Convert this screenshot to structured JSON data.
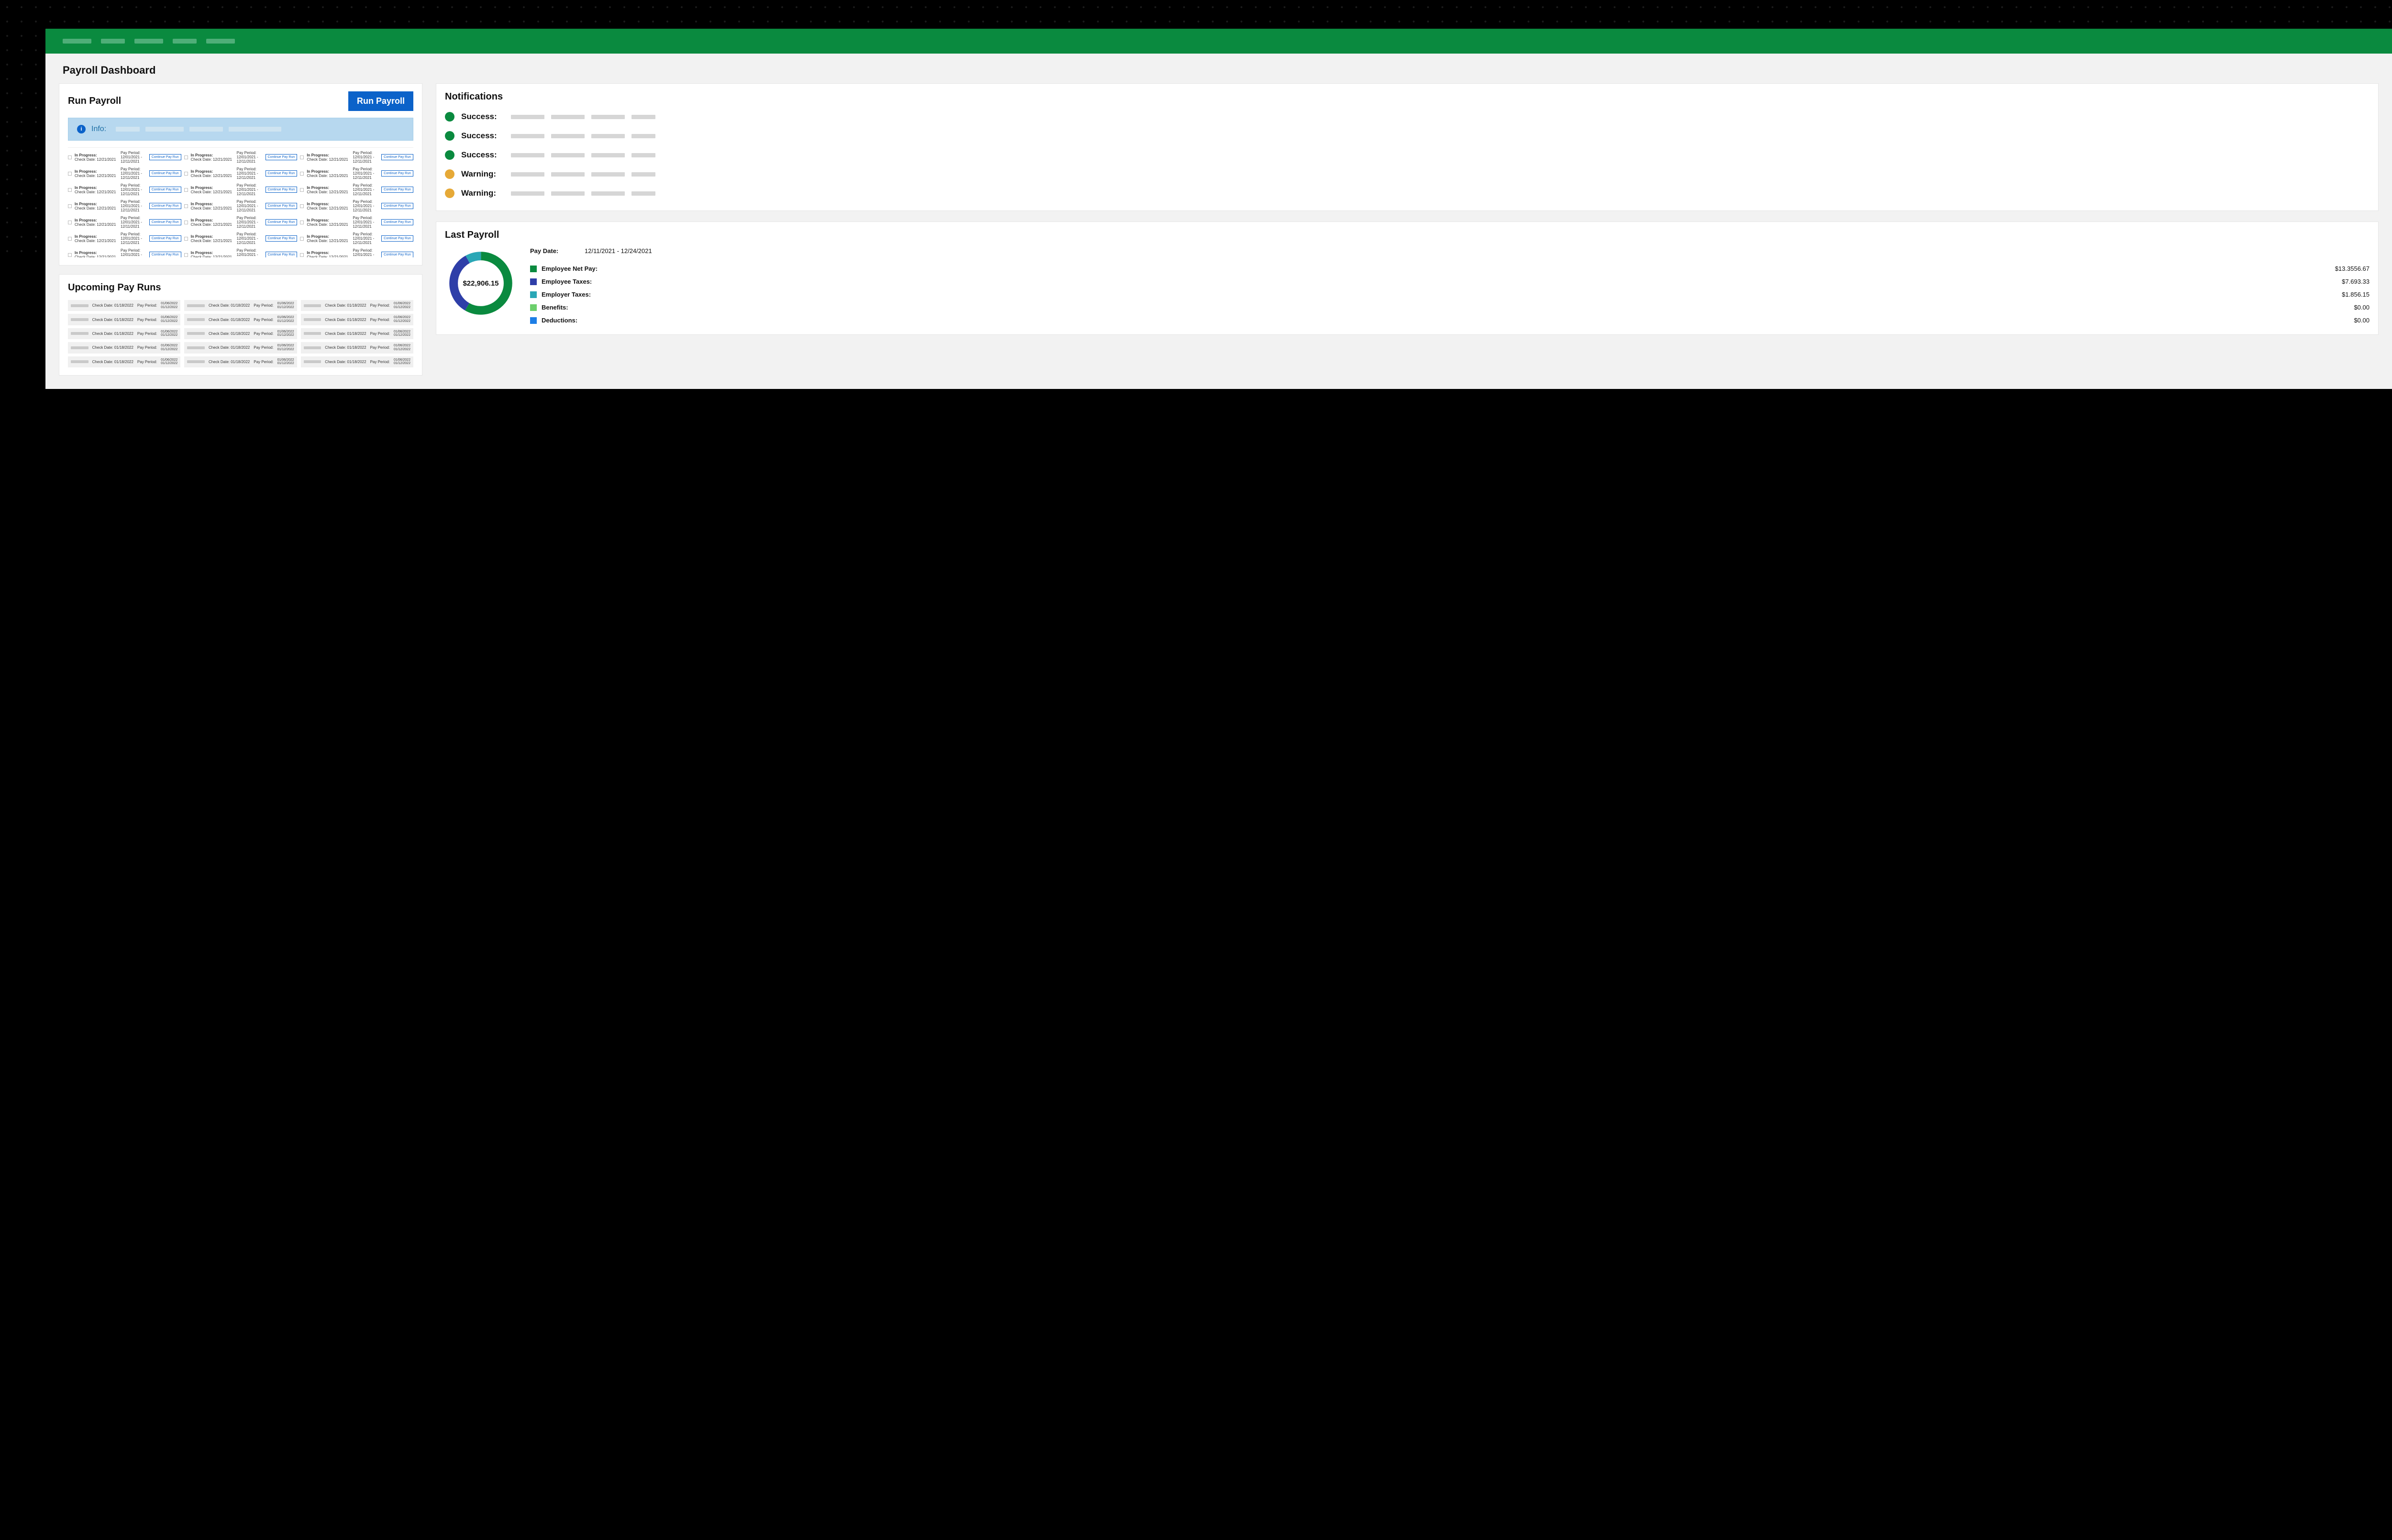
{
  "page_title": "Payroll Dashboard",
  "run_payroll": {
    "title": "Run Payroll",
    "button": "Run Payroll",
    "info_label": "Info:",
    "row": {
      "status_label": "In Progress:",
      "check_date_label": "Check Date:",
      "check_date": "12/21/2021",
      "pay_period_label": "Pay Period:",
      "pay_period": "12/01/2021 - 12/11/2021",
      "continue_button": "Continue Pay Run"
    },
    "row_count": 30
  },
  "upcoming": {
    "title": "Upcoming Pay Runs",
    "row": {
      "check_date_label": "Check Date:",
      "check_date": "01/18/2022",
      "pay_period_label": "Pay Period:",
      "date1": "01/06/2022",
      "date2": "01/12/2022"
    },
    "row_count": 15
  },
  "notifications": {
    "title": "Notifications",
    "items": [
      {
        "type": "success",
        "label": "Success:"
      },
      {
        "type": "success",
        "label": "Success:"
      },
      {
        "type": "success",
        "label": "Success:"
      },
      {
        "type": "warning",
        "label": "Warning:"
      },
      {
        "type": "warning",
        "label": "Warning:"
      }
    ]
  },
  "last_payroll": {
    "title": "Last Payroll",
    "pay_date_label": "Pay Date:",
    "pay_date_value": "12/11/2021 - 12/24/2021",
    "total": "$22,906.15",
    "legend": [
      {
        "color": "#0a8a3f",
        "name": "Employee Net Pay:",
        "value": "$13.3556.67"
      },
      {
        "color": "#2e3ea8",
        "name": "Employee Taxes:",
        "value": "$7.693.33"
      },
      {
        "color": "#2aa7b6",
        "name": "Employer Taxes:",
        "value": "$1.856.15"
      },
      {
        "color": "#6ccf6c",
        "name": "Benefits:",
        "value": "$0.00"
      },
      {
        "color": "#1d7ee6",
        "name": "Deductions:",
        "value": "$0.00"
      }
    ]
  },
  "chart_data": {
    "type": "pie",
    "title": "Last Payroll",
    "total": 22906.15,
    "series": [
      {
        "name": "Employee Net Pay",
        "value": 13355.67,
        "color": "#0a8a3f"
      },
      {
        "name": "Employee Taxes",
        "value": 7693.33,
        "color": "#2e3ea8"
      },
      {
        "name": "Employer Taxes",
        "value": 1856.15,
        "color": "#2aa7b6"
      },
      {
        "name": "Benefits",
        "value": 0.0,
        "color": "#6ccf6c"
      },
      {
        "name": "Deductions",
        "value": 0.0,
        "color": "#1d7ee6"
      }
    ]
  }
}
